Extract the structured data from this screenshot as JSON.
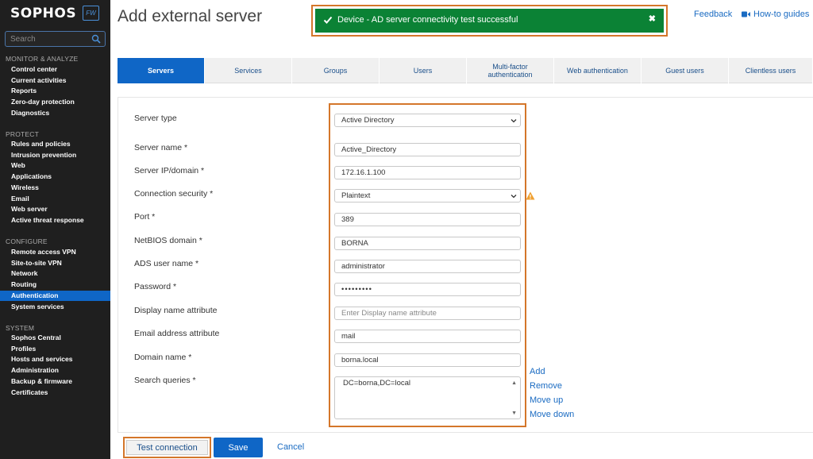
{
  "sidebar": {
    "logo": "SOPHOS",
    "badge": "FW",
    "search_placeholder": "Search",
    "sections": [
      {
        "title": "MONITOR & ANALYZE",
        "items": [
          "Control center",
          "Current activities",
          "Reports",
          "Zero-day protection",
          "Diagnostics"
        ]
      },
      {
        "title": "PROTECT",
        "items": [
          "Rules and policies",
          "Intrusion prevention",
          "Web",
          "Applications",
          "Wireless",
          "Email",
          "Web server",
          "Active threat response"
        ]
      },
      {
        "title": "CONFIGURE",
        "items": [
          "Remote access VPN",
          "Site-to-site VPN",
          "Network",
          "Routing",
          "Authentication",
          "System services"
        ]
      },
      {
        "title": "SYSTEM",
        "items": [
          "Sophos Central",
          "Profiles",
          "Hosts and services",
          "Administration",
          "Backup & firmware",
          "Certificates"
        ]
      }
    ],
    "active_item": "Authentication"
  },
  "header": {
    "title": "Add external server",
    "feedback": "Feedback",
    "howto": "How-to guides"
  },
  "toast": {
    "message": "Device - AD server connectivity test successful",
    "close": "✖"
  },
  "tabs": [
    "Servers",
    "Services",
    "Groups",
    "Users",
    "Multi-factor authentication",
    "Web authentication",
    "Guest users",
    "Clientless users"
  ],
  "form": {
    "server_type": {
      "label": "Server type",
      "value": "Active Directory"
    },
    "server_name": {
      "label": "Server name *",
      "value": "Active_Directory"
    },
    "server_ip": {
      "label": "Server IP/domain *",
      "value": "172.16.1.100"
    },
    "connection_security": {
      "label": "Connection security *",
      "value": "Plaintext"
    },
    "port": {
      "label": "Port *",
      "value": "389"
    },
    "netbios": {
      "label": "NetBIOS domain *",
      "value": "BORNA"
    },
    "ads_user": {
      "label": "ADS user name *",
      "value": "administrator"
    },
    "password": {
      "label": "Password *",
      "value": "•••••••••"
    },
    "display_name": {
      "label": "Display name attribute",
      "placeholder": "Enter Display name attribute"
    },
    "email_attr": {
      "label": "Email address attribute",
      "value": "mail"
    },
    "domain_name": {
      "label": "Domain name *",
      "value": "borna.local"
    },
    "search_queries": {
      "label": "Search queries *",
      "value": "DC=borna,DC=local"
    },
    "query_actions": {
      "add": "Add",
      "remove": "Remove",
      "move_up": "Move up",
      "move_down": "Move down"
    }
  },
  "footer": {
    "test": "Test connection",
    "save": "Save",
    "cancel": "Cancel"
  },
  "colors": {
    "accent": "#0f66c6",
    "success": "#0b8235",
    "highlight": "#d4762a",
    "sidebar_bg": "#1f1f1f"
  }
}
